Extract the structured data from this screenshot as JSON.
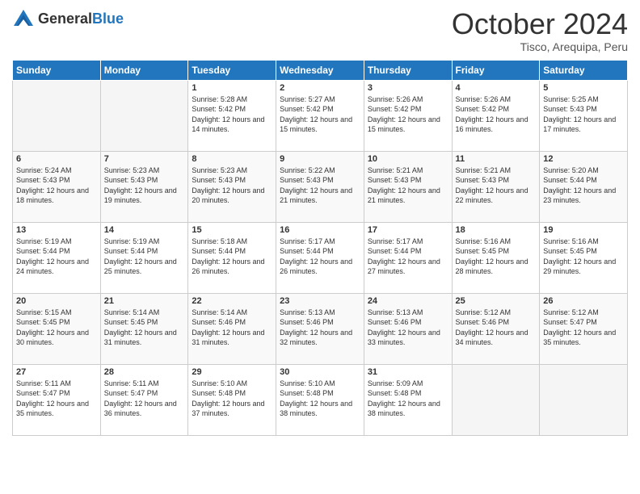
{
  "logo": {
    "general": "General",
    "blue": "Blue"
  },
  "title": {
    "month_year": "October 2024",
    "location": "Tisco, Arequipa, Peru"
  },
  "weekdays": [
    "Sunday",
    "Monday",
    "Tuesday",
    "Wednesday",
    "Thursday",
    "Friday",
    "Saturday"
  ],
  "weeks": [
    [
      {
        "day": "",
        "sunrise": "",
        "sunset": "",
        "daylight": ""
      },
      {
        "day": "",
        "sunrise": "",
        "sunset": "",
        "daylight": ""
      },
      {
        "day": "1",
        "sunrise": "Sunrise: 5:28 AM",
        "sunset": "Sunset: 5:42 PM",
        "daylight": "Daylight: 12 hours and 14 minutes."
      },
      {
        "day": "2",
        "sunrise": "Sunrise: 5:27 AM",
        "sunset": "Sunset: 5:42 PM",
        "daylight": "Daylight: 12 hours and 15 minutes."
      },
      {
        "day": "3",
        "sunrise": "Sunrise: 5:26 AM",
        "sunset": "Sunset: 5:42 PM",
        "daylight": "Daylight: 12 hours and 15 minutes."
      },
      {
        "day": "4",
        "sunrise": "Sunrise: 5:26 AM",
        "sunset": "Sunset: 5:42 PM",
        "daylight": "Daylight: 12 hours and 16 minutes."
      },
      {
        "day": "5",
        "sunrise": "Sunrise: 5:25 AM",
        "sunset": "Sunset: 5:43 PM",
        "daylight": "Daylight: 12 hours and 17 minutes."
      }
    ],
    [
      {
        "day": "6",
        "sunrise": "Sunrise: 5:24 AM",
        "sunset": "Sunset: 5:43 PM",
        "daylight": "Daylight: 12 hours and 18 minutes."
      },
      {
        "day": "7",
        "sunrise": "Sunrise: 5:23 AM",
        "sunset": "Sunset: 5:43 PM",
        "daylight": "Daylight: 12 hours and 19 minutes."
      },
      {
        "day": "8",
        "sunrise": "Sunrise: 5:23 AM",
        "sunset": "Sunset: 5:43 PM",
        "daylight": "Daylight: 12 hours and 20 minutes."
      },
      {
        "day": "9",
        "sunrise": "Sunrise: 5:22 AM",
        "sunset": "Sunset: 5:43 PM",
        "daylight": "Daylight: 12 hours and 21 minutes."
      },
      {
        "day": "10",
        "sunrise": "Sunrise: 5:21 AM",
        "sunset": "Sunset: 5:43 PM",
        "daylight": "Daylight: 12 hours and 21 minutes."
      },
      {
        "day": "11",
        "sunrise": "Sunrise: 5:21 AM",
        "sunset": "Sunset: 5:43 PM",
        "daylight": "Daylight: 12 hours and 22 minutes."
      },
      {
        "day": "12",
        "sunrise": "Sunrise: 5:20 AM",
        "sunset": "Sunset: 5:44 PM",
        "daylight": "Daylight: 12 hours and 23 minutes."
      }
    ],
    [
      {
        "day": "13",
        "sunrise": "Sunrise: 5:19 AM",
        "sunset": "Sunset: 5:44 PM",
        "daylight": "Daylight: 12 hours and 24 minutes."
      },
      {
        "day": "14",
        "sunrise": "Sunrise: 5:19 AM",
        "sunset": "Sunset: 5:44 PM",
        "daylight": "Daylight: 12 hours and 25 minutes."
      },
      {
        "day": "15",
        "sunrise": "Sunrise: 5:18 AM",
        "sunset": "Sunset: 5:44 PM",
        "daylight": "Daylight: 12 hours and 26 minutes."
      },
      {
        "day": "16",
        "sunrise": "Sunrise: 5:17 AM",
        "sunset": "Sunset: 5:44 PM",
        "daylight": "Daylight: 12 hours and 26 minutes."
      },
      {
        "day": "17",
        "sunrise": "Sunrise: 5:17 AM",
        "sunset": "Sunset: 5:44 PM",
        "daylight": "Daylight: 12 hours and 27 minutes."
      },
      {
        "day": "18",
        "sunrise": "Sunrise: 5:16 AM",
        "sunset": "Sunset: 5:45 PM",
        "daylight": "Daylight: 12 hours and 28 minutes."
      },
      {
        "day": "19",
        "sunrise": "Sunrise: 5:16 AM",
        "sunset": "Sunset: 5:45 PM",
        "daylight": "Daylight: 12 hours and 29 minutes."
      }
    ],
    [
      {
        "day": "20",
        "sunrise": "Sunrise: 5:15 AM",
        "sunset": "Sunset: 5:45 PM",
        "daylight": "Daylight: 12 hours and 30 minutes."
      },
      {
        "day": "21",
        "sunrise": "Sunrise: 5:14 AM",
        "sunset": "Sunset: 5:45 PM",
        "daylight": "Daylight: 12 hours and 31 minutes."
      },
      {
        "day": "22",
        "sunrise": "Sunrise: 5:14 AM",
        "sunset": "Sunset: 5:46 PM",
        "daylight": "Daylight: 12 hours and 31 minutes."
      },
      {
        "day": "23",
        "sunrise": "Sunrise: 5:13 AM",
        "sunset": "Sunset: 5:46 PM",
        "daylight": "Daylight: 12 hours and 32 minutes."
      },
      {
        "day": "24",
        "sunrise": "Sunrise: 5:13 AM",
        "sunset": "Sunset: 5:46 PM",
        "daylight": "Daylight: 12 hours and 33 minutes."
      },
      {
        "day": "25",
        "sunrise": "Sunrise: 5:12 AM",
        "sunset": "Sunset: 5:46 PM",
        "daylight": "Daylight: 12 hours and 34 minutes."
      },
      {
        "day": "26",
        "sunrise": "Sunrise: 5:12 AM",
        "sunset": "Sunset: 5:47 PM",
        "daylight": "Daylight: 12 hours and 35 minutes."
      }
    ],
    [
      {
        "day": "27",
        "sunrise": "Sunrise: 5:11 AM",
        "sunset": "Sunset: 5:47 PM",
        "daylight": "Daylight: 12 hours and 35 minutes."
      },
      {
        "day": "28",
        "sunrise": "Sunrise: 5:11 AM",
        "sunset": "Sunset: 5:47 PM",
        "daylight": "Daylight: 12 hours and 36 minutes."
      },
      {
        "day": "29",
        "sunrise": "Sunrise: 5:10 AM",
        "sunset": "Sunset: 5:48 PM",
        "daylight": "Daylight: 12 hours and 37 minutes."
      },
      {
        "day": "30",
        "sunrise": "Sunrise: 5:10 AM",
        "sunset": "Sunset: 5:48 PM",
        "daylight": "Daylight: 12 hours and 38 minutes."
      },
      {
        "day": "31",
        "sunrise": "Sunrise: 5:09 AM",
        "sunset": "Sunset: 5:48 PM",
        "daylight": "Daylight: 12 hours and 38 minutes."
      },
      {
        "day": "",
        "sunrise": "",
        "sunset": "",
        "daylight": ""
      },
      {
        "day": "",
        "sunrise": "",
        "sunset": "",
        "daylight": ""
      }
    ]
  ]
}
